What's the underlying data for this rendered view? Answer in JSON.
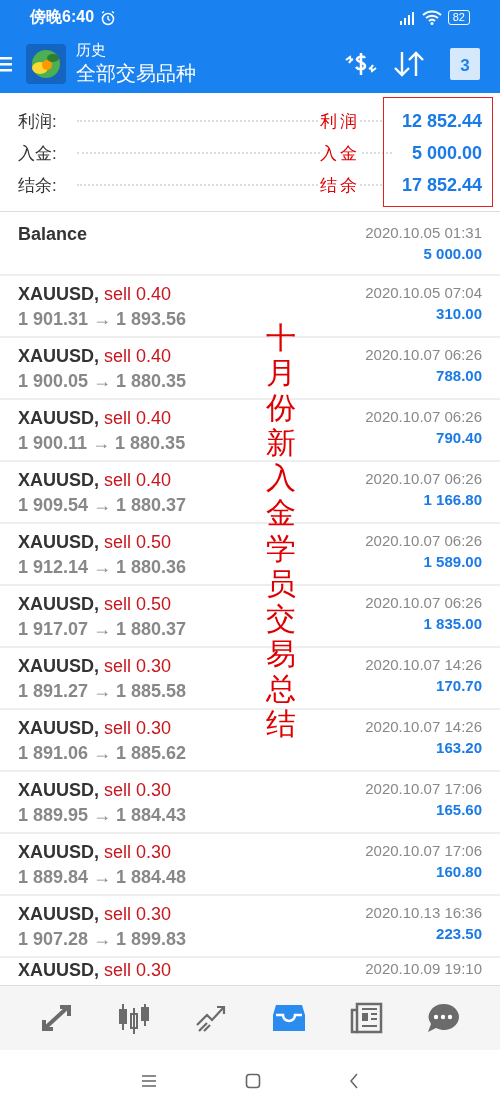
{
  "status_bar": {
    "time": "傍晚6:40",
    "battery": "82"
  },
  "header": {
    "subtitle": "历史",
    "title": "全部交易品种",
    "calendar_day": "3"
  },
  "summary": [
    {
      "label": "利润:",
      "value": "12 852.44"
    },
    {
      "label": "入金:",
      "value": "5 000.00"
    },
    {
      "label": "结余:",
      "value": "17 852.44"
    }
  ],
  "annotations": {
    "summary_notes": [
      "利润",
      "入金",
      "结余"
    ],
    "vertical_note": "十月份新入金学员交易总结"
  },
  "balance": {
    "title": "Balance",
    "time": "2020.10.05 01:31",
    "amount": "5 000.00"
  },
  "trades": [
    {
      "symbol": "XAUUSD,",
      "order": "sell 0.40",
      "prices": "1 901.31 → 1 893.56",
      "time": "2020.10.05 07:04",
      "profit": "310.00"
    },
    {
      "symbol": "XAUUSD,",
      "order": "sell 0.40",
      "prices": "1 900.05 → 1 880.35",
      "time": "2020.10.07 06:26",
      "profit": "788.00"
    },
    {
      "symbol": "XAUUSD,",
      "order": "sell 0.40",
      "prices": "1 900.11 → 1 880.35",
      "time": "2020.10.07 06:26",
      "profit": "790.40"
    },
    {
      "symbol": "XAUUSD,",
      "order": "sell 0.40",
      "prices": "1 909.54 → 1 880.37",
      "time": "2020.10.07 06:26",
      "profit": "1 166.80"
    },
    {
      "symbol": "XAUUSD,",
      "order": "sell 0.50",
      "prices": "1 912.14 → 1 880.36",
      "time": "2020.10.07 06:26",
      "profit": "1 589.00"
    },
    {
      "symbol": "XAUUSD,",
      "order": "sell 0.50",
      "prices": "1 917.07 → 1 880.37",
      "time": "2020.10.07 06:26",
      "profit": "1 835.00"
    },
    {
      "symbol": "XAUUSD,",
      "order": "sell 0.30",
      "prices": "1 891.27 → 1 885.58",
      "time": "2020.10.07 14:26",
      "profit": "170.70"
    },
    {
      "symbol": "XAUUSD,",
      "order": "sell 0.30",
      "prices": "1 891.06 → 1 885.62",
      "time": "2020.10.07 14:26",
      "profit": "163.20"
    },
    {
      "symbol": "XAUUSD,",
      "order": "sell 0.30",
      "prices": "1 889.95 → 1 884.43",
      "time": "2020.10.07 17:06",
      "profit": "165.60"
    },
    {
      "symbol": "XAUUSD,",
      "order": "sell 0.30",
      "prices": "1 889.84 → 1 884.48",
      "time": "2020.10.07 17:06",
      "profit": "160.80"
    },
    {
      "symbol": "XAUUSD,",
      "order": "sell 0.30",
      "prices": "1 907.28 → 1 899.83",
      "time": "2020.10.13 16:36",
      "profit": "223.50"
    }
  ],
  "partial_trade": {
    "symbol": "XAUUSD,",
    "order": "sell 0.30",
    "time": "2020.10.09 19:10"
  },
  "bottom_nav": [
    {
      "kind": "trade",
      "selected": false
    },
    {
      "kind": "quotes",
      "selected": false
    },
    {
      "kind": "chart",
      "selected": false
    },
    {
      "kind": "history",
      "selected": true
    },
    {
      "kind": "news",
      "selected": false
    },
    {
      "kind": "chat",
      "selected": false
    }
  ]
}
